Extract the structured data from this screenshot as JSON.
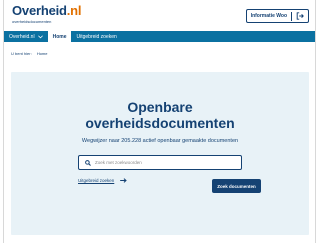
{
  "header": {
    "logo_name": "Overheid",
    "logo_suffix": ".nl",
    "logo_subtitle": "overheidsdocumenten",
    "info_button_label": "Informatie Woo"
  },
  "nav": {
    "items": [
      {
        "label": "Overheid.nl",
        "icon": "chevron-down-icon"
      },
      {
        "label": "Home",
        "active": true
      },
      {
        "label": "Uitgebreid zoeken"
      }
    ]
  },
  "breadcrumb": {
    "prefix": "U bent hier:",
    "current": "Home"
  },
  "hero": {
    "title_line1": "Openbare",
    "title_line2": "overheidsdocumenten",
    "subtitle": "Wegwijzer naar 205.228 actief openbaar gemaakte documenten",
    "search_placeholder": "Zoek met zoekwoorden",
    "advanced_link": "Uitgebreid zoeken",
    "search_button": "Zoek documenten"
  },
  "colors": {
    "brand": "#154273",
    "nav": "#0b71a1",
    "hero_bg": "#e8f2f7",
    "accent": "#e17000"
  }
}
